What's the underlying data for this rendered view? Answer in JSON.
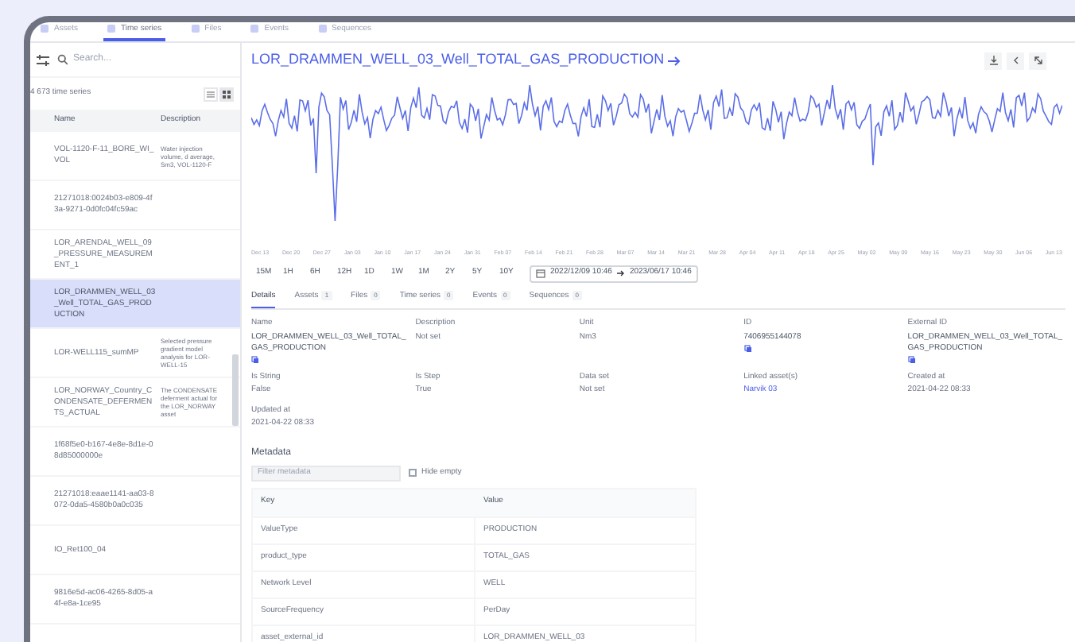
{
  "top_tabs": [
    {
      "label": "Assets",
      "selected": false
    },
    {
      "label": "Time series",
      "selected": true
    },
    {
      "label": "Files",
      "selected": false
    },
    {
      "label": "Events",
      "selected": false
    },
    {
      "label": "Sequences",
      "selected": false
    }
  ],
  "sidebar": {
    "search_placeholder": "Search...",
    "count": "4 673 time series",
    "columns": [
      "Name",
      "Description"
    ],
    "rows": [
      {
        "name": "VOL-1120-F-11_BORE_WI_VOL",
        "description": "Water injection volume, d average, Sm3, VOL-1120-F",
        "selected": false
      },
      {
        "name": "21271018:0024b03-e809-4f3a-9271-0d0fc04fc59ac",
        "selected": false
      },
      {
        "name": "LOR_ARENDAL_WELL_09_PRESSURE_MEASUREMENT_1",
        "selected": false
      },
      {
        "name": "LOR_DRAMMEN_WELL_03_Well_TOTAL_GAS_PRODUCTION",
        "selected": true
      },
      {
        "name": "LOR-WELL115_sumMP",
        "description": "Selected pressure gradient model analysis for LOR-WELL-15",
        "selected": false
      },
      {
        "name": "LOR_NORWAY_Country_CONDENSATE_DEFERMENTS_ACTUAL",
        "description": "The CONDENSATE deferment actual for the LOR_NORWAY asset",
        "selected": false
      },
      {
        "name": "1f68f5e0-b167-4e8e-8d1e-08d85000000e",
        "selected": false
      },
      {
        "name": "21271018:eaae1141-aa03-8072-0da5-4580b0a0c035",
        "selected": false
      },
      {
        "name": "IO_Ret100_04",
        "selected": false
      },
      {
        "name": "9816e5d-ac06-4265-8d05-a4f-e8a-1ce95",
        "selected": false
      }
    ]
  },
  "main": {
    "title": "LOR_DRAMMEN_WELL_03_Well_TOTAL_GAS_PRODUCTION",
    "x_ticks": [
      "Dec 13",
      "Dec 20",
      "Dec 27",
      "Jan 03",
      "Jan 10",
      "Jan 17",
      "Jan 24",
      "Jan 31",
      "Feb 07",
      "Feb 14",
      "Feb 21",
      "Feb 28",
      "Mar 07",
      "Mar 14",
      "Mar 21",
      "Mar 28",
      "Apr 04",
      "Apr 11",
      "Apr 18",
      "Apr 25",
      "May 02",
      "May 09",
      "May 16",
      "May 23",
      "May 30",
      "Jun 06",
      "Jun 13"
    ],
    "range_buttons": [
      "15M",
      "1H",
      "6H",
      "12H",
      "1D",
      "1W",
      "1M",
      "2Y",
      "5Y",
      "10Y"
    ],
    "date_range": {
      "start": "2022/12/09 10:46",
      "end": "2023/06/17 10:46"
    },
    "detail_tabs": [
      {
        "label": "Details",
        "selected": true
      },
      {
        "label": "Assets",
        "count": "1",
        "selected": false
      },
      {
        "label": "Files",
        "count": "0",
        "selected": false
      },
      {
        "label": "Time series",
        "count": "0",
        "selected": false
      },
      {
        "label": "Events",
        "count": "0",
        "selected": false
      },
      {
        "label": "Sequences",
        "count": "0",
        "selected": false
      }
    ],
    "details": [
      {
        "label": "Name",
        "value": "LOR_DRAMMEN_WELL_03_Well_TOTAL_GAS_PRODUCTION",
        "kind": "copyable"
      },
      {
        "label": "Description",
        "value": "Not set",
        "kind": "text"
      },
      {
        "label": "Unit",
        "value": "Nm3",
        "kind": "text"
      },
      {
        "label": "ID",
        "value": "7406955144078",
        "kind": "copyable"
      },
      {
        "label": "External ID",
        "value": "LOR_DRAMMEN_WELL_03_Well_TOTAL_GAS_PRODUCTION",
        "kind": "copyable"
      },
      {
        "label": "Is String",
        "value": "False",
        "kind": "text"
      },
      {
        "label": "Is Step",
        "value": "True",
        "kind": "text"
      },
      {
        "label": "Data set",
        "value": "Not set",
        "kind": "text"
      },
      {
        "label": "Linked asset(s)",
        "value": "Narvik 03",
        "kind": "link"
      },
      {
        "label": "Created at",
        "value": "2021-04-22 08:33",
        "kind": "text"
      },
      {
        "label": "Updated at",
        "value": "2021-04-22 08:33",
        "kind": "text"
      }
    ],
    "metadata": {
      "title": "Metadata",
      "filter_placeholder": "Filter metadata",
      "hide_empty": {
        "label": "Hide empty",
        "checked": false
      },
      "columns": [
        "Key",
        "Value"
      ],
      "rows": [
        [
          "ValueType",
          "PRODUCTION"
        ],
        [
          "product_type",
          "TOTAL_GAS"
        ],
        [
          "Network Level",
          "WELL"
        ],
        [
          "SourceFrequency",
          "PerDay"
        ],
        [
          "asset_external_id",
          "LOR_DRAMMEN_WELL_03"
        ]
      ]
    }
  }
}
